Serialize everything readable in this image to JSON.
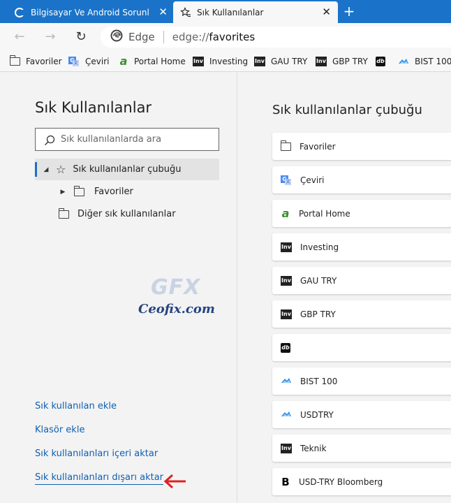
{
  "tabs": [
    {
      "title": "Bilgisayar Ve Android Sorunlarına",
      "close": "✕"
    },
    {
      "title": "Sık Kullanılanlar",
      "close": "✕"
    }
  ],
  "new_tab": "+",
  "toolbar": {
    "back": "←",
    "forward": "→",
    "refresh": "↻",
    "site_label": "Edge",
    "url_scheme": "edge://",
    "url_path": "favorites"
  },
  "favorites_bar": [
    {
      "label": "Favoriler",
      "icon": "folder-icon"
    },
    {
      "label": "Çeviri",
      "icon": "google-translate-icon"
    },
    {
      "label": "Portal Home",
      "icon": "portal-icon"
    },
    {
      "label": "Investing",
      "icon": "investing-icon"
    },
    {
      "label": "GAU TRY",
      "icon": "investing-icon"
    },
    {
      "label": "GBP TRY",
      "icon": "investing-icon"
    },
    {
      "label": "",
      "icon": "db-icon"
    },
    {
      "label": "BIST 100",
      "icon": "cloud-icon"
    }
  ],
  "left": {
    "title": "Sık Kullanılanlar",
    "search_placeholder": "Sık kullanılanlarda ara",
    "tree": [
      {
        "label": "Sık kullanılanlar çubuğu"
      },
      {
        "label": "Favoriler"
      },
      {
        "label": "Diğer sık kullanılanlar"
      }
    ],
    "links": [
      {
        "label": "Sık kullanılan ekle"
      },
      {
        "label": "Klasör ekle"
      },
      {
        "label": "Sık kullanılanları içeri aktar"
      },
      {
        "label": "Sık kullanılanları dışarı aktar"
      }
    ]
  },
  "watermark": {
    "logo": "GFX",
    "text": "Ceofix.com"
  },
  "right": {
    "title": "Sık kullanılanlar çubuğu",
    "items": [
      {
        "label": "Favoriler",
        "icon": "folder-icon"
      },
      {
        "label": "Çeviri",
        "icon": "google-translate-icon"
      },
      {
        "label": "Portal Home",
        "icon": "portal-icon"
      },
      {
        "label": "Investing",
        "icon": "investing-icon"
      },
      {
        "label": "GAU TRY",
        "icon": "investing-icon"
      },
      {
        "label": "GBP TRY",
        "icon": "investing-icon"
      },
      {
        "label": "",
        "icon": "db-icon"
      },
      {
        "label": "BIST 100",
        "icon": "cloud-icon"
      },
      {
        "label": "USDTRY",
        "icon": "cloud-icon"
      },
      {
        "label": "Teknik",
        "icon": "investing-icon"
      },
      {
        "label": "USD-TRY Bloomberg",
        "icon": "bloomberg-icon"
      }
    ]
  },
  "colors": {
    "tabstrip": "#1a73c8",
    "link": "#0f5fb0",
    "accent": "#1a6fc8",
    "arrow": "#e02020"
  }
}
